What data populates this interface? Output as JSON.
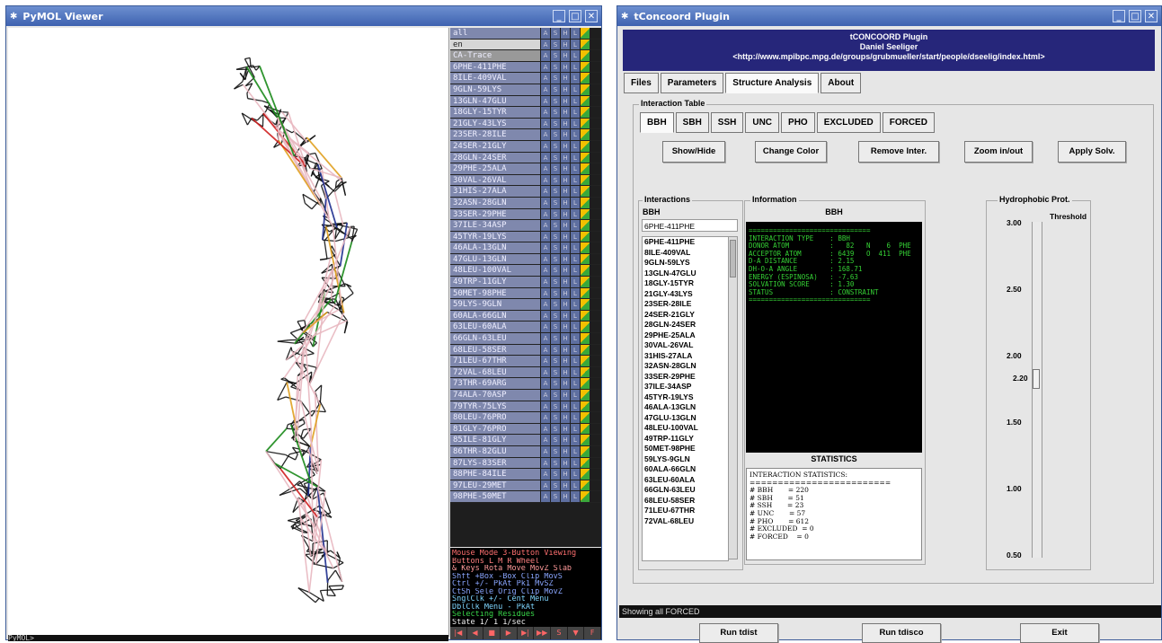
{
  "pymol": {
    "title": "PyMOL Viewer",
    "cmd_prompt": "PyMOL>",
    "objects": [
      "all",
      "en",
      "CA-Trace",
      "6PHE-411PHE",
      "8ILE-409VAL",
      "9GLN-59LYS",
      "13GLN-47GLU",
      "18GLY-15TYR",
      "21GLY-43LYS",
      "23SER-28ILE",
      "24SER-21GLY",
      "28GLN-24SER",
      "29PHE-25ALA",
      "30VAL-26VAL",
      "31HIS-27ALA",
      "32ASN-28GLN",
      "33SER-29PHE",
      "37ILE-34ASP",
      "45TYR-19LYS",
      "46ALA-13GLN",
      "47GLU-13GLN",
      "48LEU-100VAL",
      "49TRP-11GLY",
      "50MET-98PHE",
      "59LYS-9GLN",
      "60ALA-66GLN",
      "63LEU-60ALA",
      "66GLN-63LEU",
      "68LEU-58SER",
      "71LEU-67THR",
      "72VAL-68LEU",
      "73THR-69ARG",
      "74ALA-70ASP",
      "79TYR-75LYS",
      "80LEU-76PRO",
      "81GLY-76PRO",
      "85ILE-81GLY",
      "86THR-82GLU",
      "87LYS-83SER",
      "88PHE-84ILE",
      "97LEU-29MET",
      "98PHE-50MET"
    ],
    "object_buttons": [
      "A",
      "S",
      "H",
      "L"
    ],
    "mouse_lines": [
      "Mouse Mode 3-Button Viewing",
      "Buttons  L    M    R  Wheel",
      "& Keys Rota Move MovZ Slab",
      "  Shft +Box -Box Clip MovS",
      "  Ctrl +/-  PkAt Pk1  MvSZ",
      "  CtSh Sele Orig Clip MovZ",
      "SnglClk +/-  Cent Menu",
      "DblClk Menu  -   PkAt",
      "Selecting Residues",
      "State  1/   1 1/sec"
    ],
    "playbar": [
      "|◀",
      "◀",
      "■",
      "▶",
      "▶|",
      "▶▶",
      "S",
      "▼",
      "F"
    ]
  },
  "tconcoord": {
    "title": "tConcoord Plugin",
    "header_lines": [
      "tCONCOORD Plugin",
      "Daniel Seeliger",
      "<http://www.mpibpc.mpg.de/groups/grubmueller/start/people/dseelig/index.html>"
    ],
    "tabs": [
      "Files",
      "Parameters",
      "Structure Analysis",
      "About"
    ],
    "group_title": "Interaction Table",
    "subtabs": [
      "BBH",
      "SBH",
      "SSH",
      "UNC",
      "PHO",
      "EXCLUDED",
      "FORCED"
    ],
    "actions": [
      "Show/Hide",
      "Change Color",
      "Remove Inter.",
      "Zoom in/out",
      "Apply Solv."
    ],
    "interactions_label": "Interactions",
    "interactions_type": "BBH",
    "interaction_entry": "6PHE-411PHE",
    "interactions": [
      "6PHE-411PHE",
      "8ILE-409VAL",
      "9GLN-59LYS",
      "13GLN-47GLU",
      "18GLY-15TYR",
      "21GLY-43LYS",
      "23SER-28ILE",
      "24SER-21GLY",
      "28GLN-24SER",
      "29PHE-25ALA",
      "30VAL-26VAL",
      "31HIS-27ALA",
      "32ASN-28GLN",
      "33SER-29PHE",
      "37ILE-34ASP",
      "45TYR-19LYS",
      "46ALA-13GLN",
      "47GLU-13GLN",
      "48LEU-100VAL",
      "49TRP-11GLY",
      "50MET-98PHE",
      "59LYS-9GLN",
      "60ALA-66GLN",
      "63LEU-60ALA",
      "66GLN-63LEU",
      "68LEU-58SER",
      "71LEU-67THR",
      "72VAL-68LEU"
    ],
    "information_label": "Information",
    "information_type": "BBH",
    "info_text": "==============================\nINTERACTION TYPE    : BBH\nDONOR ATOM          :   82   N    6  PHE\nACCEPTOR ATOM       : 6439   O  411  PHE\nD-A DISTANCE        : 2.15\nDH-O-A ANGLE        : 168.71\nENERGY (ESPINOSA)   : -7.63\nSOLVATION SCORE     : 1.30\nSTATUS              : CONSTRAINT\n==============================",
    "statistics_label": "STATISTICS",
    "stats_text": "INTERACTION STATISTICS:\n=========================\n# BBH       = 220\n# SBH       = 51\n# SSH       = 23\n# UNC       = 57\n# PHO       = 612\n# EXCLUDED  = 0\n# FORCED    = 0",
    "hydro_label": "Hydrophobic Prot.",
    "threshold_label": "Threshold",
    "slider_value": "2.20",
    "slider_fraction": 0.467,
    "ticks": [
      "3.00",
      "2.50",
      "2.00",
      "1.50",
      "1.00",
      "0.50"
    ],
    "status": "Showing all FORCED",
    "run_buttons": [
      "Run tdist",
      "Run tdisco",
      "Exit"
    ]
  }
}
